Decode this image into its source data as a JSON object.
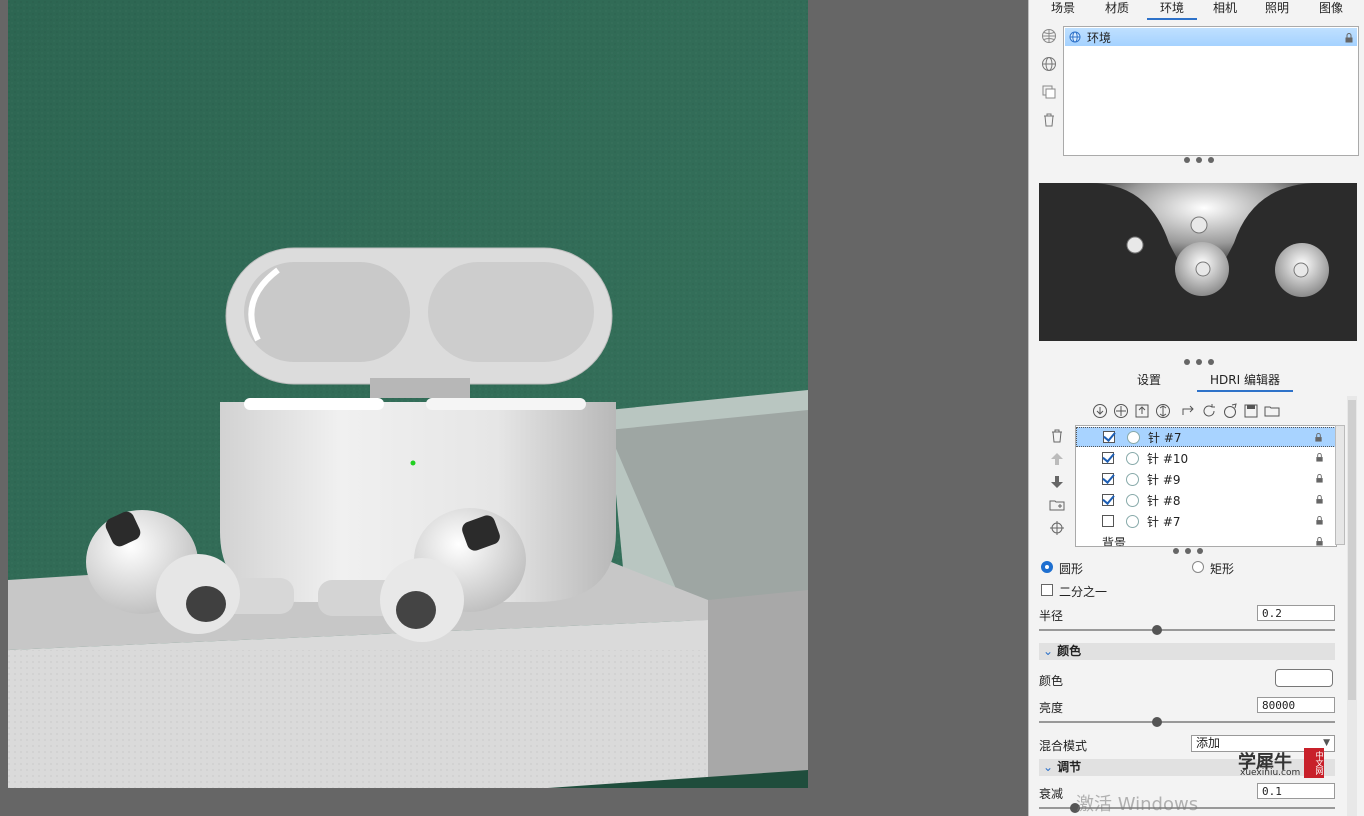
{
  "tabs": [
    "场景",
    "材质",
    "环境",
    "相机",
    "照明",
    "图像"
  ],
  "active_tab": 2,
  "environment_list": [
    {
      "name": "环境"
    }
  ],
  "subtabs": [
    "设置",
    "HDRI 编辑器"
  ],
  "active_subtab": 1,
  "lights": [
    {
      "name": "针 #7",
      "checked": true,
      "selected": true
    },
    {
      "name": "针 #10",
      "checked": true,
      "selected": false
    },
    {
      "name": "针 #9",
      "checked": true,
      "selected": false
    },
    {
      "name": "针 #8",
      "checked": true,
      "selected": false
    },
    {
      "name": "针 #7",
      "checked": false,
      "selected": false
    },
    {
      "name": "背景",
      "checked": false,
      "selected": false
    }
  ],
  "shape": {
    "circle_label": "圆形",
    "rect_label": "矩形",
    "selected": "circle"
  },
  "half_label": "二分之一",
  "radius": {
    "label": "半径",
    "value": "0.2",
    "slider_fraction": 0.4
  },
  "color_section": {
    "title": "颜色",
    "color_label": "颜色",
    "color_value": "#ffffff"
  },
  "brightness": {
    "label": "亮度",
    "value": "80000",
    "slider_fraction": 0.4
  },
  "blend": {
    "label": "混合模式",
    "value": "添加"
  },
  "adjust_section": {
    "title": "调节"
  },
  "falloff": {
    "label": "衰减",
    "value": "0.1",
    "slider_fraction": 0.12
  },
  "watermark": "激活 Windows",
  "brand": {
    "name": "学犀牛",
    "url": "xuexiniu.com",
    "badge": "中文网"
  },
  "colors": {
    "accent": "#2e72c9",
    "wall": "#2f6a56",
    "panel": "#f3f3f3"
  }
}
